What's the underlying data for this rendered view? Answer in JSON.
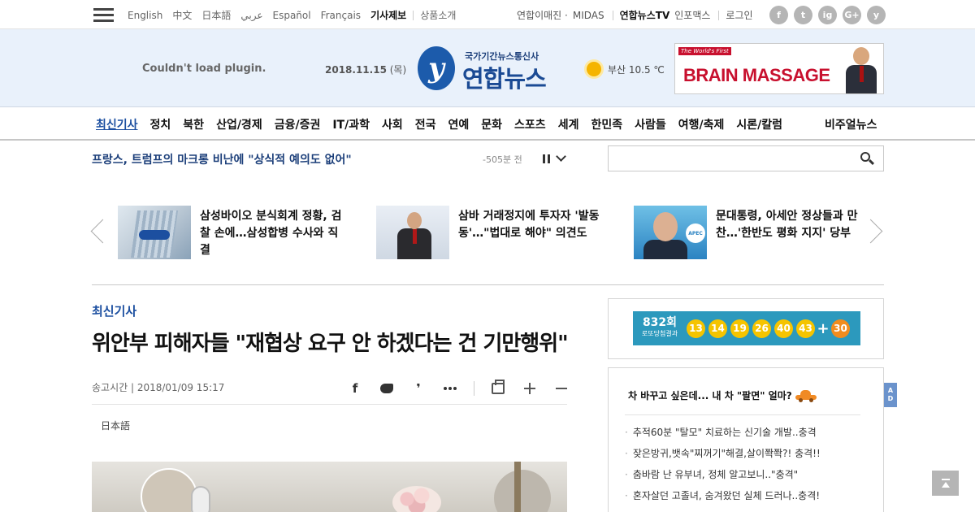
{
  "topbar": {
    "languages": [
      "English",
      "中文",
      "日本語",
      "عربي",
      "Español",
      "Français"
    ],
    "tip_label": "기사제보",
    "products_label": "상품소개",
    "utils": {
      "magazine": "연합이매진 ·",
      "midas": "MIDAS",
      "tv": "연합뉴스TV",
      "infomax": "인포맥스",
      "login": "로그인"
    },
    "social": [
      "f",
      "t",
      "ig",
      "G+",
      "y"
    ]
  },
  "header": {
    "plugin_notice": "Couldn't load plugin.",
    "date": "2018.11.15",
    "weekday": "(목)",
    "logo_sub": "국가기간뉴스통신사",
    "logo_main": "연합뉴스",
    "weather_text": "부산 10.5 ℃",
    "ad": {
      "tag": "The World's First",
      "text": "BRAIN MASSAGE"
    }
  },
  "nav": {
    "items": [
      "최신기사",
      "정치",
      "북한",
      "산업/경제",
      "금융/증권",
      "IT/과학",
      "사회",
      "전국",
      "연예",
      "문화",
      "스포츠",
      "세계",
      "한민족",
      "사람들",
      "여행/축제",
      "시론/칼럼"
    ],
    "active": "최신기사",
    "visual_news": "비주얼뉴스"
  },
  "ticker": {
    "headline": "프랑스, 트럼프의 마크롱 비난에 \"상식적 예의도 없어\"",
    "time": "-505분 전"
  },
  "search": {
    "placeholder": ""
  },
  "carousel": [
    {
      "headline": "삼성바이오 분식회계 정황, 검찰 손에…삼성합병 수사와 직결"
    },
    {
      "headline": "삼바 거래정지에 투자자 '발동동'…\"법대로 해야\" 의견도"
    },
    {
      "headline": "문대통령, 아세안 정상들과 만찬…'한반도 평화 지지' 당부",
      "thumb_logo": "APEC"
    }
  ],
  "article": {
    "category": "최신기사",
    "title": "위안부 피해자들 \"재협상 요구 안 하겠다는 건 기만행위\"",
    "meta": "송고시간 | 2018/01/09 15:17",
    "language_link": "日本語"
  },
  "lotto": {
    "round": "832회",
    "label": "로또당첨결과",
    "numbers": [
      "13",
      "14",
      "19",
      "26",
      "40",
      "43"
    ],
    "plus": "+",
    "bonus": "30"
  },
  "promo": {
    "title": "차 바꾸고 싶은데... 내 차 \"팔면\" 얼마?",
    "items": [
      "추적60분 \"탈모\" 치료하는 신기술 개발..충격",
      "잦은방귀,뱃속\"찌꺼기\"해결,살이쫙쫙?! 충격!!",
      "춤바람 난 유부녀, 정체 알고보니..\"충격\"",
      "혼자살던 고졸녀, 숨겨왔던 실체 드러나..충격!"
    ]
  },
  "ad_tab": [
    "A",
    "D"
  ]
}
